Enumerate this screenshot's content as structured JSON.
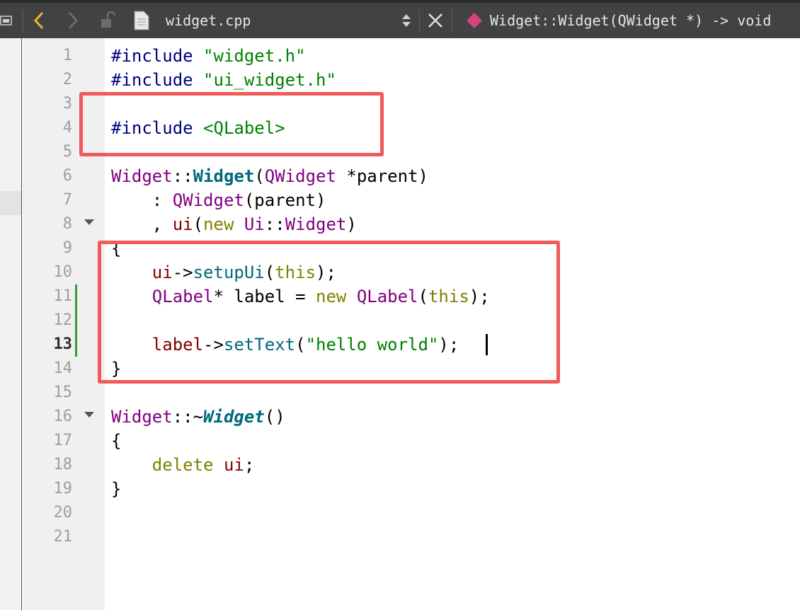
{
  "editor": {
    "filename": "widget.cpp",
    "current_function": "Widget::Widget(QWidget *) -> void",
    "current_line": 13
  },
  "code": {
    "line_numbers": [
      "1",
      "2",
      "3",
      "4",
      "5",
      "6",
      "7",
      "8",
      "9",
      "10",
      "11",
      "12",
      "13",
      "14",
      "15",
      "16",
      "17",
      "18",
      "19",
      "20",
      "21"
    ],
    "l1a": "#include",
    "l1b": "\"widget.h\"",
    "l2a": "#include",
    "l2b": "\"ui_widget.h\"",
    "l4a": "#include",
    "l4b": "<QLabel>",
    "l6": [
      "Widget",
      "::",
      "Widget",
      "(",
      "QWidget",
      " *parent",
      ")"
    ],
    "l7": [
      "    : ",
      "QWidget",
      "(parent)"
    ],
    "l8": [
      "    , ",
      "ui",
      "(",
      "new",
      " ",
      "Ui",
      "::",
      "Widget",
      ")"
    ],
    "l9": "{",
    "l10": [
      "    ",
      "ui",
      "->",
      "setupUi",
      "(",
      "this",
      ");"
    ],
    "l11": [
      "    ",
      "QLabel",
      "* label = ",
      "new",
      " ",
      "QLabel",
      "(",
      "this",
      ");"
    ],
    "l13": [
      "    ",
      "label",
      "->",
      "setText",
      "(",
      "\"hello world\"",
      ");"
    ],
    "l14": "}",
    "l16": [
      "Widget",
      "::~",
      "Widget",
      "()"
    ],
    "l17": "{",
    "l18": [
      "    ",
      "delete",
      " ",
      "ui",
      ";"
    ],
    "l19": "}"
  },
  "colors": {
    "toolbar": "#404244",
    "highlight_box": "#f05a5a",
    "back_arrow": "#f0b429",
    "func_marker": "#d6457a"
  }
}
